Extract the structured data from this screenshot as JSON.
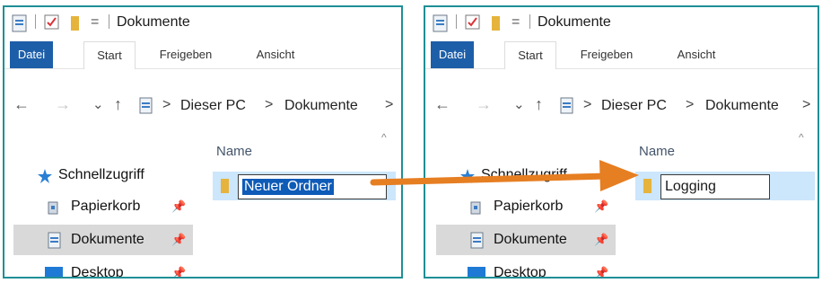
{
  "window_left": {
    "title": "Dokumente",
    "qat_dropdown": "=",
    "tabs": [
      "Datei",
      "Start",
      "Freigeben",
      "Ansicht"
    ],
    "breadcrumb": [
      "Dieser PC",
      "Dokumente"
    ],
    "nav_glyphs": {
      "back": "←",
      "forward": "→",
      "recent": "⌄",
      "up": "↑",
      "sep": ">",
      "scroll": "^"
    },
    "column_header": "Name",
    "sidebar": [
      {
        "label": "Schnellzugriff",
        "icon": "star-icon"
      },
      {
        "label": "Papierkorb",
        "icon": "recycle-bin-icon"
      },
      {
        "label": "Dokumente",
        "icon": "documents-icon"
      },
      {
        "label": "Desktop",
        "icon": "desktop-icon"
      }
    ],
    "folder_rename_value": "Neuer Ordner"
  },
  "window_right": {
    "title": "Dokumente",
    "qat_dropdown": "=",
    "tabs": [
      "Datei",
      "Start",
      "Freigeben",
      "Ansicht"
    ],
    "breadcrumb": [
      "Dieser PC",
      "Dokumente"
    ],
    "nav_glyphs": {
      "back": "←",
      "forward": "→",
      "recent": "⌄",
      "up": "↑",
      "sep": ">",
      "scroll": "^"
    },
    "column_header": "Name",
    "sidebar": [
      {
        "label": "Schnellzugriff",
        "icon": "star-icon"
      },
      {
        "label": "Papierkorb",
        "icon": "recycle-bin-icon"
      },
      {
        "label": "Dokumente",
        "icon": "documents-icon"
      },
      {
        "label": "Desktop",
        "icon": "desktop-icon"
      }
    ],
    "folder_rename_value": "Logging"
  },
  "colors": {
    "frame": "#1f8f96",
    "arrow": "#e67e22",
    "file_tab": "#1d5ea8",
    "selection": "#cce6fb"
  }
}
